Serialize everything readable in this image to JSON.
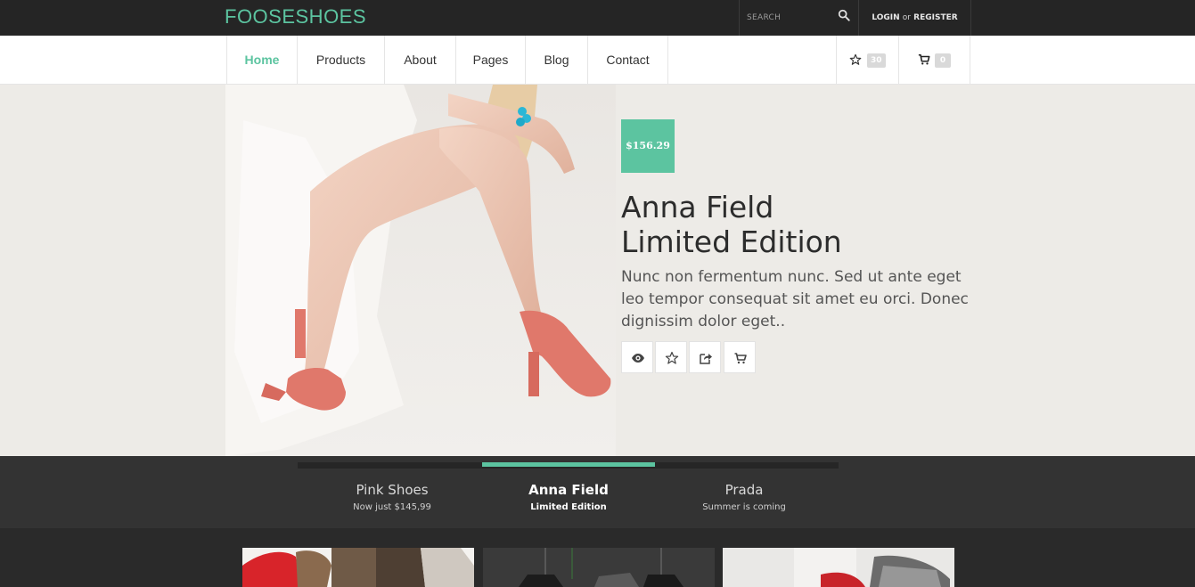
{
  "brand": {
    "logo": "FOOSESHOES",
    "accent": "#5cc4a0"
  },
  "topbar": {
    "search_placeholder": "SEARCH",
    "login": "LOGIN",
    "or": "or",
    "register": "REGISTER"
  },
  "nav": {
    "items": [
      {
        "label": "Home",
        "active": true
      },
      {
        "label": "Products"
      },
      {
        "label": "About"
      },
      {
        "label": "Pages"
      },
      {
        "label": "Blog"
      },
      {
        "label": "Contact"
      }
    ],
    "wishlist_count": "30",
    "cart_count": "0"
  },
  "hero": {
    "price": "$156.29",
    "title_line1": "Anna Field",
    "title_line2": "Limited Edition",
    "description": "Nunc non fermentum nunc. Sed ut ante eget leo tempor consequat sit amet eu orci. Donec dignissim dolor eget..",
    "actions": [
      "eye-icon",
      "star-icon",
      "share-icon",
      "cart-icon"
    ]
  },
  "slider_tabs": [
    {
      "title": "Pink Shoes",
      "subtitle": "Now just $145,99"
    },
    {
      "title": "Anna Field",
      "subtitle": "Limited Edition",
      "active": true
    },
    {
      "title": "Prada",
      "subtitle": "Summer is coming"
    }
  ]
}
